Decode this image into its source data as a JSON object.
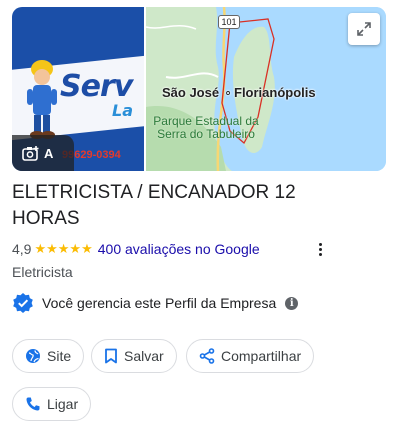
{
  "media": {
    "photo_brand_text": "Serv",
    "photo_brand_sub": "La",
    "photo_phone": "99629-0394",
    "photo_button_label": "A",
    "map": {
      "route_shield": "101",
      "city_1": "São José",
      "city_2": "Florianópolis",
      "park_label": "Parque Estadual da Serra do Tabuleiro",
      "water_color": "#aadaff",
      "land_color": "#cfe8c9"
    }
  },
  "business": {
    "title": "ELETRICISTA / ENCANADOR 12 HORAS",
    "rating": "4,9",
    "stars": "★★★★★",
    "reviews_label": "400 avaliações no Google",
    "category": "Eletricista",
    "managed_text": "Você gerencia este Perfil da Empresa",
    "info_glyph": "i"
  },
  "actions": {
    "site": "Site",
    "save": "Salvar",
    "share": "Compartilhar",
    "call": "Ligar"
  },
  "colors": {
    "accent_blue": "#1a73e8",
    "star_yellow": "#fbbc04",
    "link_blue": "#1a0dab"
  }
}
